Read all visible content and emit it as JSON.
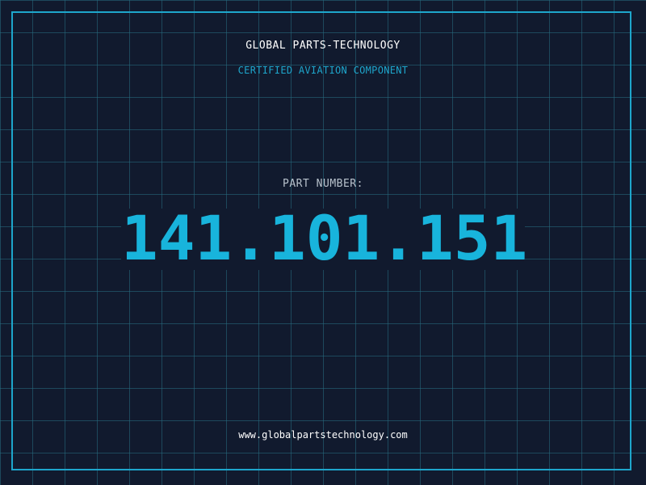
{
  "header": {
    "company": "GLOBAL PARTS-TECHNOLOGY",
    "tagline": "CERTIFIED AVIATION COMPONENT"
  },
  "part": {
    "label": "PART NUMBER:",
    "number": "141.101.151"
  },
  "footer": {
    "website": "www.globalpartstechnology.com"
  },
  "colors": {
    "background": "#111a2e",
    "grid": "#266e82",
    "accent": "#1ea6cc",
    "part_number": "#18b4dc",
    "label": "#b8c2cc",
    "text": "#ffffff"
  }
}
